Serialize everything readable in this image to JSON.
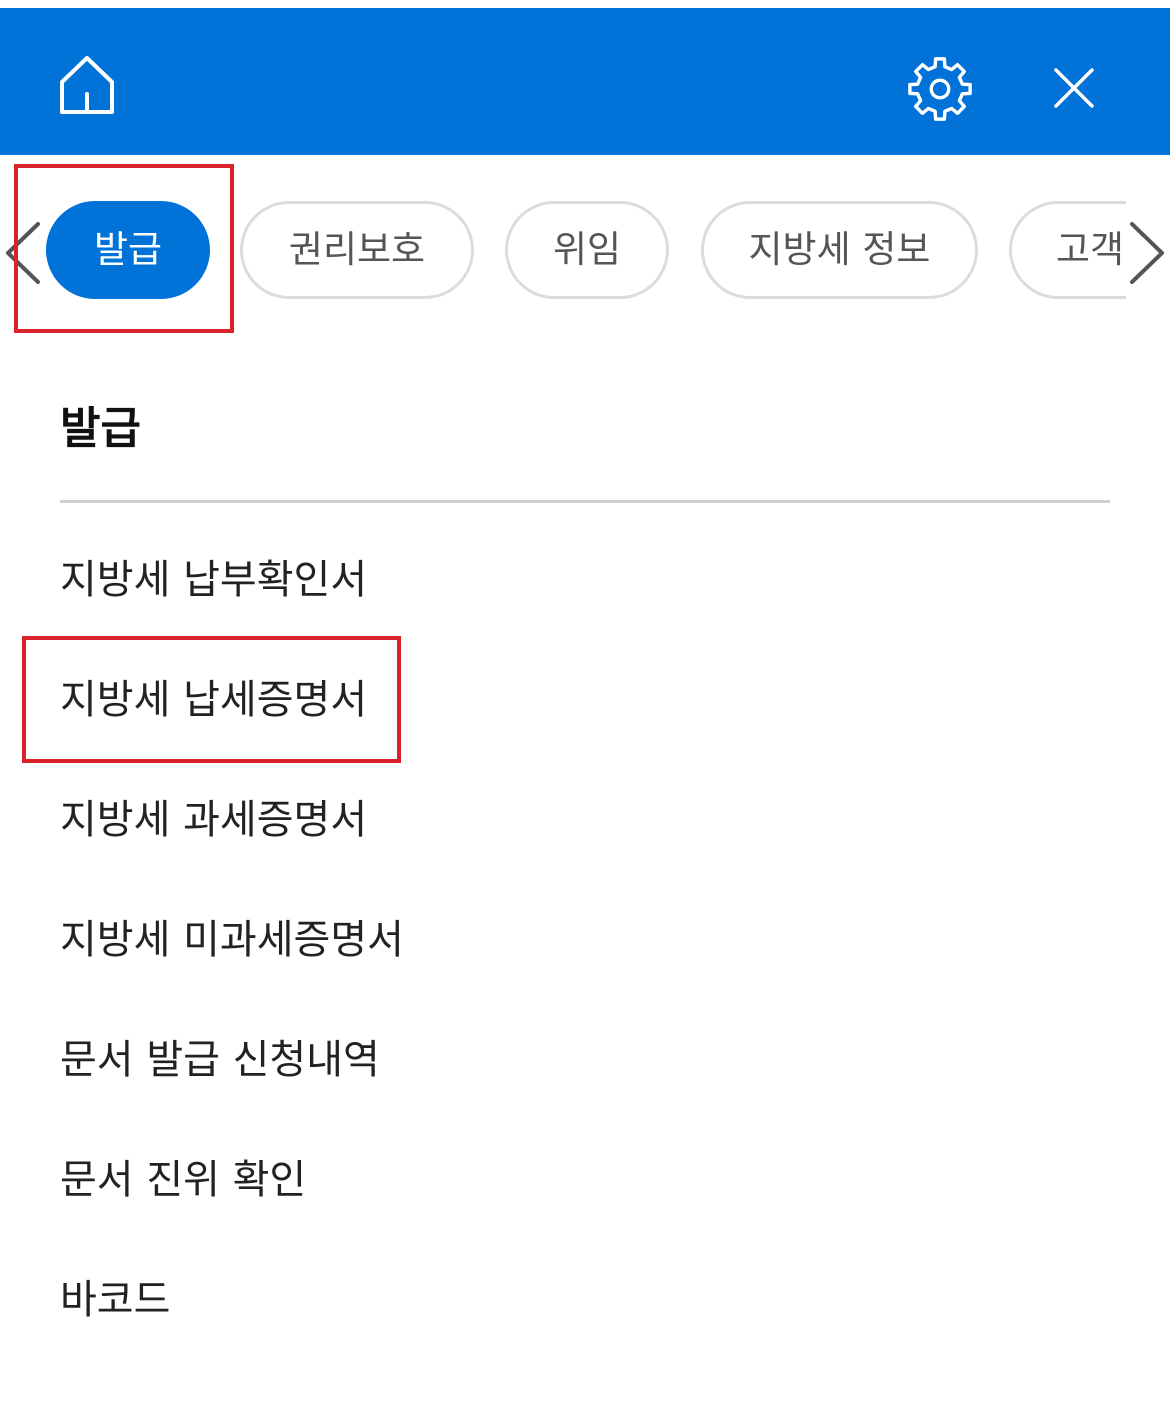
{
  "header": {
    "background_color": "#0072d8",
    "icons": {
      "home": "home-icon",
      "settings": "gear-icon",
      "close": "close-icon"
    }
  },
  "tabs": {
    "items": [
      {
        "label": "발급",
        "active": true
      },
      {
        "label": "권리보호",
        "active": false
      },
      {
        "label": "위임",
        "active": false
      },
      {
        "label": "지방세 정보",
        "active": false
      },
      {
        "label": "고객",
        "active": false
      }
    ],
    "prev_icon": "chevron-left-icon",
    "next_icon": "chevron-right-icon",
    "active_color": "#0072d8"
  },
  "section": {
    "title": "발급",
    "items": [
      {
        "label": "지방세 납부확인서"
      },
      {
        "label": "지방세 납세증명서"
      },
      {
        "label": "지방세 과세증명서"
      },
      {
        "label": "지방세 미과세증명서"
      },
      {
        "label": "문서 발급 신청내역"
      },
      {
        "label": "문서 진위 확인"
      },
      {
        "label": "바코드"
      }
    ]
  },
  "highlight_color": "#d9222a"
}
